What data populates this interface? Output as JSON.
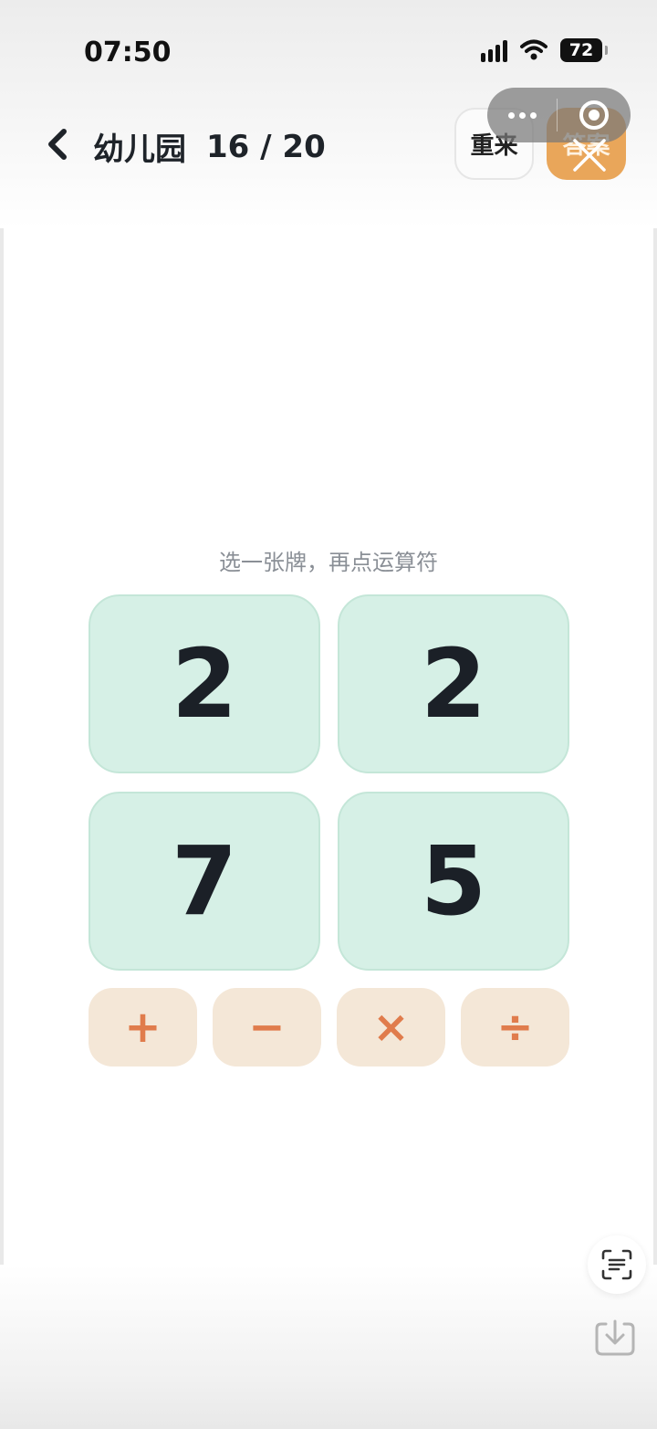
{
  "status_bar": {
    "time": "07:50",
    "battery": "72"
  },
  "header": {
    "title": "幼儿园",
    "progress": "16 / 20"
  },
  "buttons": {
    "restart": "重来",
    "answer": "答案"
  },
  "hint": "选一张牌，再点运算符",
  "cards": [
    "2",
    "2",
    "7",
    "5"
  ],
  "operators": [
    "+",
    "−",
    "×",
    "÷"
  ],
  "colors": {
    "card_bg": "#d6f0e6",
    "operator_bg": "#f4e7d7",
    "operator_fg": "#e07c4c",
    "answer_bg": "#e9a65a"
  }
}
